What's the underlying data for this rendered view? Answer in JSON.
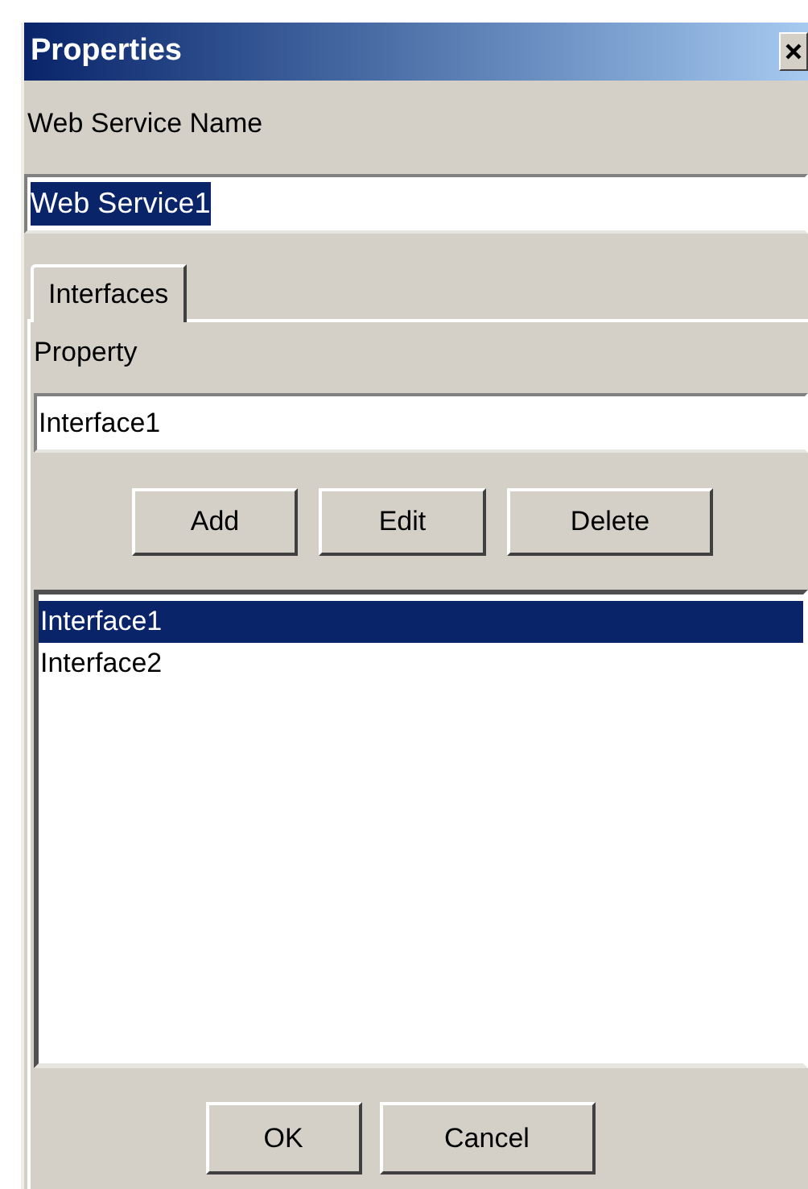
{
  "window": {
    "title": "Properties"
  },
  "name_field": {
    "label": "Web Service Name",
    "value": "Web Service1",
    "text_selected": true
  },
  "tabs": [
    {
      "label": "Interfaces",
      "selected": true
    }
  ],
  "property_field": {
    "label": "Property",
    "value": "Interface1"
  },
  "actions": [
    "Add",
    "Edit",
    "Delete"
  ],
  "list": [
    {
      "label": "Interface1",
      "selected": true
    },
    {
      "label": "Interface2",
      "selected": false
    }
  ],
  "buttons": [
    "OK",
    "Cancel"
  ]
}
